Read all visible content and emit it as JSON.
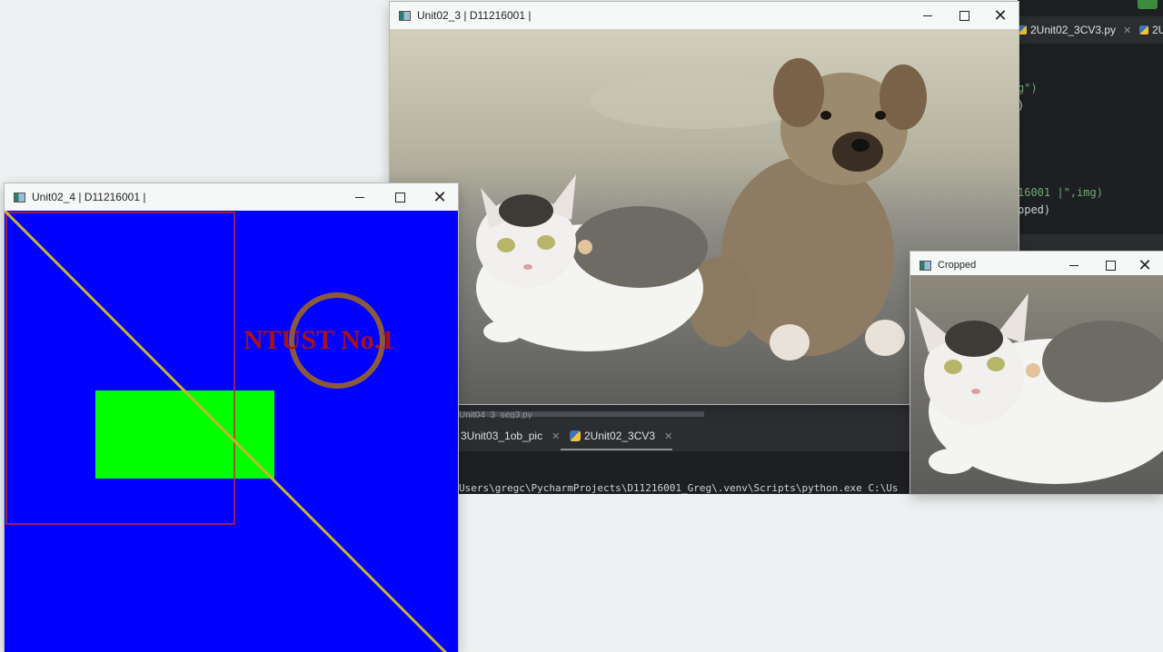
{
  "windows": {
    "photo_window": {
      "title": "Unit02_3 | D11216001 |"
    },
    "draw_window": {
      "title": "Unit02_4 | D11216001 |",
      "canvas_text": "NTUST No.1"
    },
    "cropped_window": {
      "title": "Cropped"
    }
  },
  "ide": {
    "top_tabs": [
      {
        "label": "2Unit02_3CV3.py"
      },
      {
        "label": "2U"
      }
    ],
    "code_lines": [
      "g\")",
      ")",
      "16001 |\",img)",
      "pped)"
    ],
    "bottom_tabs": [
      {
        "label": "Unit04_3_seg3.py"
      },
      {
        "label": "3Unit03_1ob_pic"
      },
      {
        "label": "2Unit02_3CV3"
      }
    ],
    "terminal_line": "Users\\gregc\\PycharmProjects\\D11216001_Greg\\.venv\\Scripts\\python.exe C:\\Us"
  },
  "colors": {
    "canvas_blue": "#0000ff",
    "rect_green": "#00ff00",
    "line_yellow": "#c8b431",
    "text_red": "#a8111a",
    "circle_brown": "#8b5a3c",
    "outline_red": "#d2222d"
  },
  "icons": [
    "app-window-icon",
    "python-file-icon",
    "close-icon",
    "minimize-icon",
    "maximize-icon"
  ]
}
